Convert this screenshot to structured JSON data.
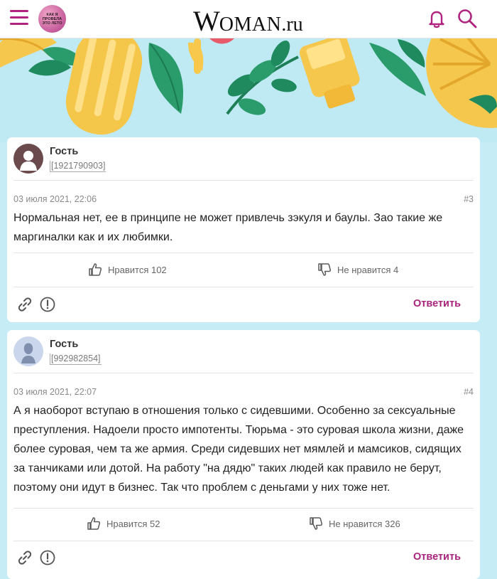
{
  "header": {
    "promo_badge": "КАК Я ПРОВЕЛА ЭТО ЛЕТО",
    "logo_w": "W",
    "logo_caps": "OMAN",
    "logo_tld": ".ru",
    "icons": [
      "menu-icon",
      "bell-icon",
      "search-icon"
    ]
  },
  "colors": {
    "accent": "#a8237e",
    "background": "#c6ecf5",
    "card": "#ffffff"
  },
  "comments": [
    {
      "author": "Гость",
      "id": "[1921790903]",
      "date": "03 июля 2021, 22:06",
      "number": "#3",
      "text": "Нормальная нет, ее в принципе не может привлечь зэкуля и баулы. Зао такие же маргиналки как и их любимки.",
      "like_label": "Нравится 102",
      "dislike_label": "Не нравится 4",
      "reply_label": "Ответить"
    },
    {
      "author": "Гость",
      "id": "[992982854]",
      "date": "03 июля 2021, 22:07",
      "number": "#4",
      "text": "А я наоборот вступаю в отношения только с сидевшими. Особенно за сексуальные преступления. Надоели просто импотенты. Тюрьма - это суровая школа жизни, даже более суровая, чем та же армия. Среди сидевших нет мямлей и мамсиков, сидящих за танчиками или дотой. На работу \"на дядю\" таких людей как правило не берут, поэтому они идут в бизнес. Так что проблем с деньгами у них тоже нет.",
      "like_label": "Нравится 52",
      "dislike_label": "Не нравится 326",
      "reply_label": "Ответить"
    }
  ]
}
